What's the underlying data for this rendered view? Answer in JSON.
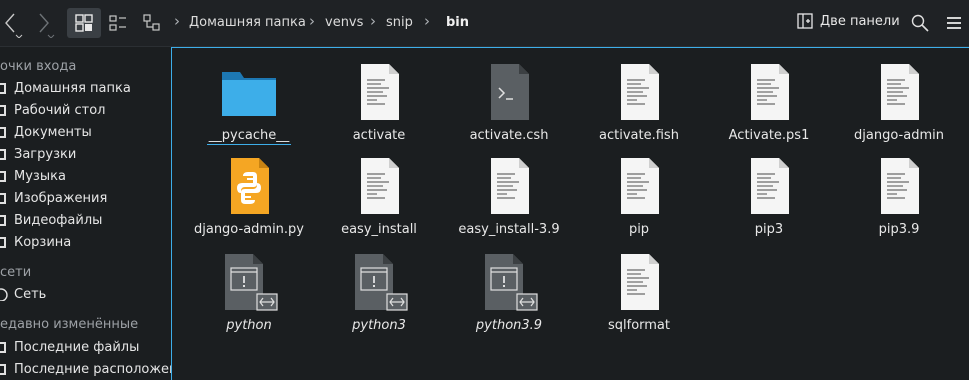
{
  "toolbar": {
    "breadcrumbs": [
      "Домашняя папка",
      "venvs",
      "snip",
      "bin"
    ],
    "two_panes_label": "Две панели"
  },
  "sidebar": {
    "places_header": "очки входа",
    "places": [
      {
        "label": "Домашняя папка"
      },
      {
        "label": "Рабочий стол"
      },
      {
        "label": "Документы"
      },
      {
        "label": "Загрузки"
      },
      {
        "label": "Музыка"
      },
      {
        "label": "Изображения"
      },
      {
        "label": "Видеофайлы"
      },
      {
        "label": "Корзина"
      }
    ],
    "network_header": "сети",
    "network": [
      {
        "label": "Сеть"
      }
    ],
    "recent_header": "едавно изменённые",
    "recent": [
      {
        "label": "Последние файлы"
      },
      {
        "label": "Последние расположения"
      }
    ]
  },
  "files": [
    {
      "name": "__pycache__",
      "type": "folder",
      "style": "underlined"
    },
    {
      "name": "activate",
      "type": "text",
      "style": ""
    },
    {
      "name": "activate.csh",
      "type": "script",
      "style": ""
    },
    {
      "name": "activate.fish",
      "type": "text",
      "style": ""
    },
    {
      "name": "Activate.ps1",
      "type": "text",
      "style": ""
    },
    {
      "name": "django-admin",
      "type": "text",
      "style": ""
    },
    {
      "name": "django-admin.py",
      "type": "python",
      "style": ""
    },
    {
      "name": "easy_install",
      "type": "text",
      "style": ""
    },
    {
      "name": "easy_install-3.9",
      "type": "text",
      "style": ""
    },
    {
      "name": "pip",
      "type": "text",
      "style": ""
    },
    {
      "name": "pip3",
      "type": "text",
      "style": ""
    },
    {
      "name": "pip3.9",
      "type": "text",
      "style": ""
    },
    {
      "name": "python",
      "type": "exec-link",
      "style": "italic"
    },
    {
      "name": "python3",
      "type": "exec-link",
      "style": "italic"
    },
    {
      "name": "python3.9",
      "type": "exec-link",
      "style": "italic"
    },
    {
      "name": "sqlformat",
      "type": "text",
      "style": ""
    }
  ],
  "colors": {
    "accent": "#3daee9",
    "folder": "#3daee9",
    "python_file": "#f5a623"
  }
}
